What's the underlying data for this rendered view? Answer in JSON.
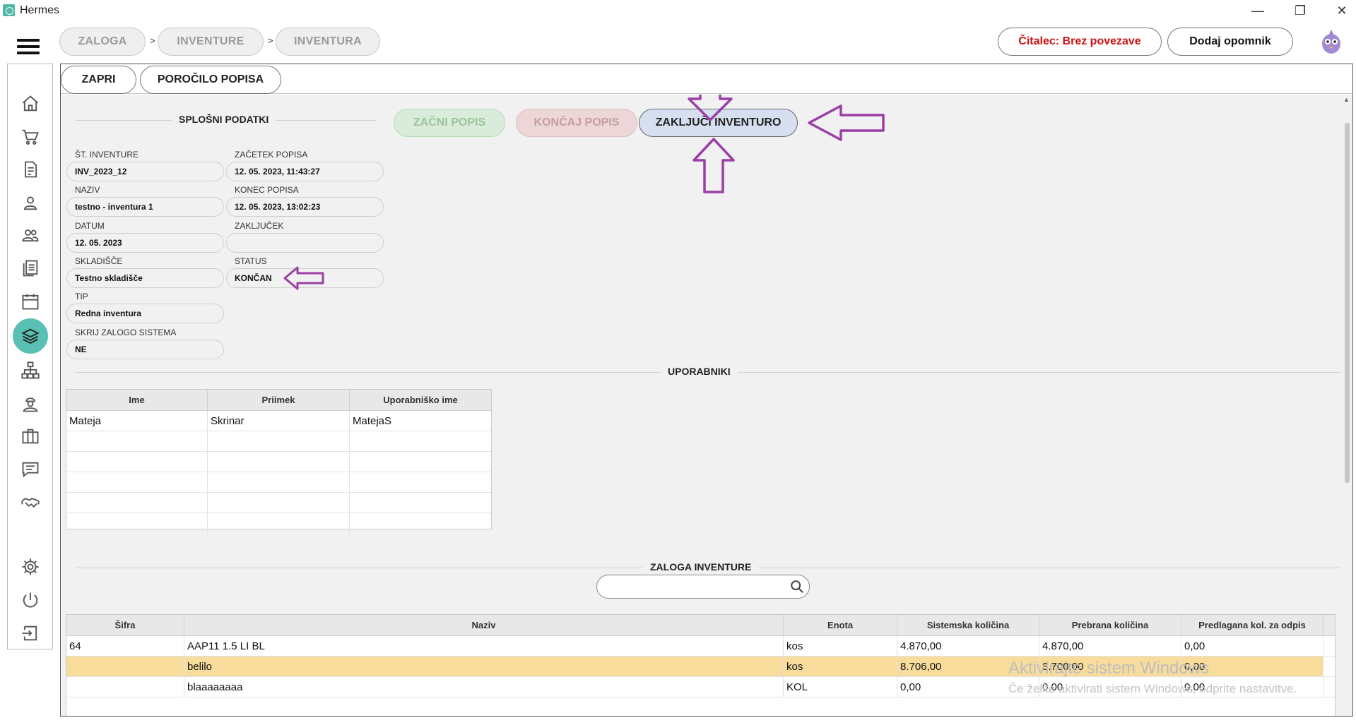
{
  "window": {
    "title": "Hermes",
    "minimize": "—",
    "maximize": "❐",
    "close": "✕"
  },
  "breadcrumb": [
    "ZALOGA",
    "INVENTURE",
    "INVENTURA"
  ],
  "breadcrumb_sep": ">",
  "header": {
    "reader_status": "Čitalec: Brez povezave",
    "add_reminder": "Dodaj opomnik"
  },
  "colors": {
    "accent": "#58c1b4",
    "reader_status": "#cc1111",
    "arrow": "#9b3ea6",
    "highlight_row": "#f7dc9c"
  },
  "nav_icons": [
    "home-icon",
    "cart-icon",
    "document-icon",
    "person-icon",
    "people-icon",
    "list-icon",
    "calendar-icon",
    "layers-icon",
    "hierarchy-icon",
    "worker-icon",
    "briefcase-icon",
    "chat-icon",
    "handshake-icon",
    "gear-icon",
    "power-icon",
    "logout-icon"
  ],
  "tabs": {
    "close": "ZAPRI",
    "report": "POROČILO POPISA"
  },
  "actions": {
    "start": "ZAČNI POPIS",
    "end": "KONČAJ POPIS",
    "finalize": "ZAKLJUČI INVENTURO"
  },
  "general": {
    "title": "SPLOŠNI PODATKI",
    "inv_no_label": "ŠT. INVENTURE",
    "inv_no": "INV_2023_12",
    "name_label": "NAZIV",
    "name": "testno - inventura 1",
    "date_label": "DATUM",
    "date": "12. 05. 2023",
    "warehouse_label": "SKLADIŠČE",
    "warehouse": "Testno skladišče",
    "type_label": "TIP",
    "type": "Redna inventura",
    "hide_label": "SKRIJ ZALOGO SISTEMA",
    "hide": "NE",
    "start_label": "ZAČETEK POPISA",
    "start": "12. 05. 2023, 11:43:27",
    "end_label": "KONEC POPISA",
    "end": "12. 05. 2023, 13:02:23",
    "closing_label": "ZAKLJUČEK",
    "closing": "",
    "status_label": "STATUS",
    "status": "KONČAN"
  },
  "users": {
    "title": "UPORABNIKI",
    "columns": [
      "Ime",
      "Priimek",
      "Uporabniško ime"
    ],
    "rows": [
      [
        "Mateja",
        "Skrinar",
        "MatejaS"
      ]
    ]
  },
  "stock": {
    "title": "ZALOGA INVENTURE",
    "search_placeholder": "",
    "columns": [
      "Šifra",
      "Naziv",
      "Enota",
      "Sistemska količina",
      "Prebrana količina",
      "Predlagana kol. za odpis"
    ],
    "rows": [
      [
        "64",
        "AAP11 1.5 LI BL",
        "kos",
        "4.870,00",
        "4.870,00",
        "0,00"
      ],
      [
        "",
        "belilo",
        "kos",
        "8.706,00",
        "8.700,00",
        "0,00"
      ],
      [
        "",
        "blaaaaaaaa",
        "KOL",
        "0,00",
        "0,00",
        "0,00"
      ]
    ]
  },
  "watermark": {
    "line1": "Aktivirajte sistem Windows",
    "line2": "Če želite aktivirati sistem Windows, odprite nastavitve."
  }
}
